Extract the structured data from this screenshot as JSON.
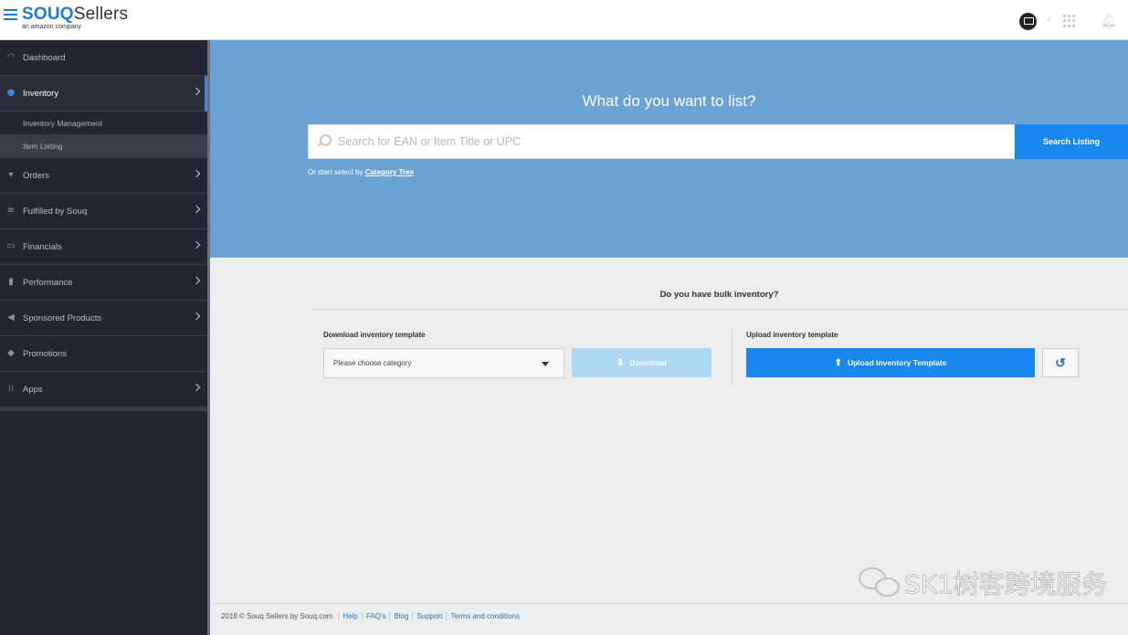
{
  "header": {
    "logo_souq": "SOUQ",
    "logo_sellers": "Sellers",
    "logo_sub": "an amazon company"
  },
  "sidebar": {
    "items": [
      {
        "label": "Dashboard",
        "icon": "gauge-icon"
      },
      {
        "label": "Inventory",
        "icon": "inventory-icon",
        "active": true
      },
      {
        "label": "Orders",
        "icon": "cart-icon"
      },
      {
        "label": "Fulfilled by Souq",
        "icon": "truck-icon"
      },
      {
        "label": "Financials",
        "icon": "money-icon"
      },
      {
        "label": "Performance",
        "icon": "bar-chart-icon"
      },
      {
        "label": "Sponsored Products",
        "icon": "megaphone-icon"
      },
      {
        "label": "Promotions",
        "icon": "tag-icon"
      },
      {
        "label": "Apps",
        "icon": "apps-grid-icon"
      }
    ],
    "inventory_sub": [
      {
        "label": "Inventory Management"
      },
      {
        "label": "Item Listing",
        "selected": true
      }
    ]
  },
  "hero": {
    "title": "What do you want to list?",
    "search_placeholder": "Search for EAN or Item Title or UPC",
    "search_button": "Search Listing",
    "category_prefix": "Or start select by ",
    "category_link": "Category Tree",
    "background_color": "#6aa2d3"
  },
  "bulk": {
    "title": "Do you have bulk inventory?",
    "download_label": "Download inventory template",
    "category_select_value": "Please choose category",
    "download_button": "Download",
    "upload_label": "Upload inventory template",
    "upload_button": "Upload Inventory Template",
    "accent_color": "#1a87f0"
  },
  "footer": {
    "copyright": "2018 © Souq Sellers by Souq.com",
    "links": [
      "Help",
      "FAQ's",
      "Blog",
      "Support",
      "Terms and conditions"
    ]
  },
  "watermark": {
    "text": "SK1树客跨境服务"
  }
}
